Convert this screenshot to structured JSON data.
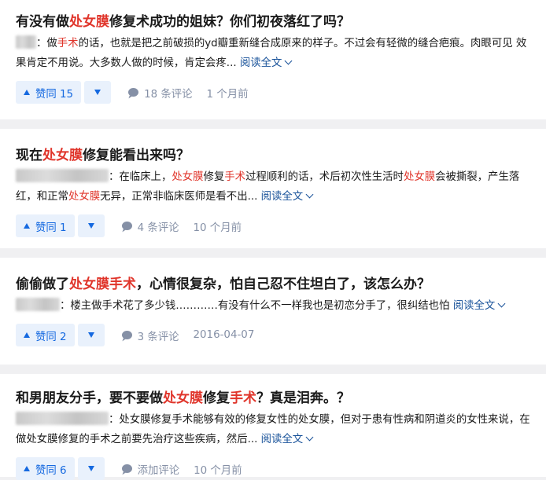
{
  "cards": [
    {
      "title_a": "有没有做",
      "title_hl1": "处女膜",
      "title_b": "修复术成功的姐妹？你们初夜落红了吗？",
      "ex_a": "：做",
      "ex_hl1": "手术",
      "ex_b": "的话，也就是把之前破损的yd瓣重新缝合成原来的样子。不过会有轻微的缝合疤痕。肉眼可见 效果肯定不用说。大多数人做的时候，肯定会疼...",
      "read_more": "阅读全文",
      "vote": "赞同 15",
      "comments": "18 条评论",
      "time": "1 个月前"
    },
    {
      "title_a": "现在",
      "title_hl1": "处女膜",
      "title_b": "修复能看出来吗？",
      "ex_a": "：在临床上，",
      "ex_hl1": "处女膜",
      "ex_b": "修复",
      "ex_hl2": "手术",
      "ex_c": "过程顺利的话，术后初次性生活时",
      "ex_hl3": "处女膜",
      "ex_d": "会被撕裂，产生落红，和正常",
      "ex_hl4": "处女膜",
      "ex_e": "无异，正常非临床医师是看不出...",
      "read_more": "阅读全文",
      "vote": "赞同 1",
      "comments": "4 条评论",
      "time": "10 个月前"
    },
    {
      "title_a": "偷偷做了",
      "title_hl1": "处女膜手术",
      "title_b": "，心情很复杂，怕自己忍不住坦白了，该怎么办？",
      "ex_a": "：楼主做手术花了多少钱…………有没有什么不一样我也是初恋分手了，很纠结也怕",
      "read_more": "阅读全文",
      "vote": "赞同 2",
      "comments": "3 条评论",
      "time": "2016-04-07"
    },
    {
      "title_a": "和男朋友分手，要不要做",
      "title_hl1": "处女膜",
      "title_b": "修复",
      "title_hl2": "手术",
      "title_c": "？真是泪奔。？",
      "ex_a": "：处女膜修复手术能够有效的修复女性的处女膜，但对于患有性病和阴道炎的女性来说，在做处女膜修复的手术之前要先治疗这些疾病，然后...",
      "read_more": "阅读全文",
      "vote": "赞同 6",
      "comments": "添加评论",
      "time": "10 个月前"
    }
  ]
}
